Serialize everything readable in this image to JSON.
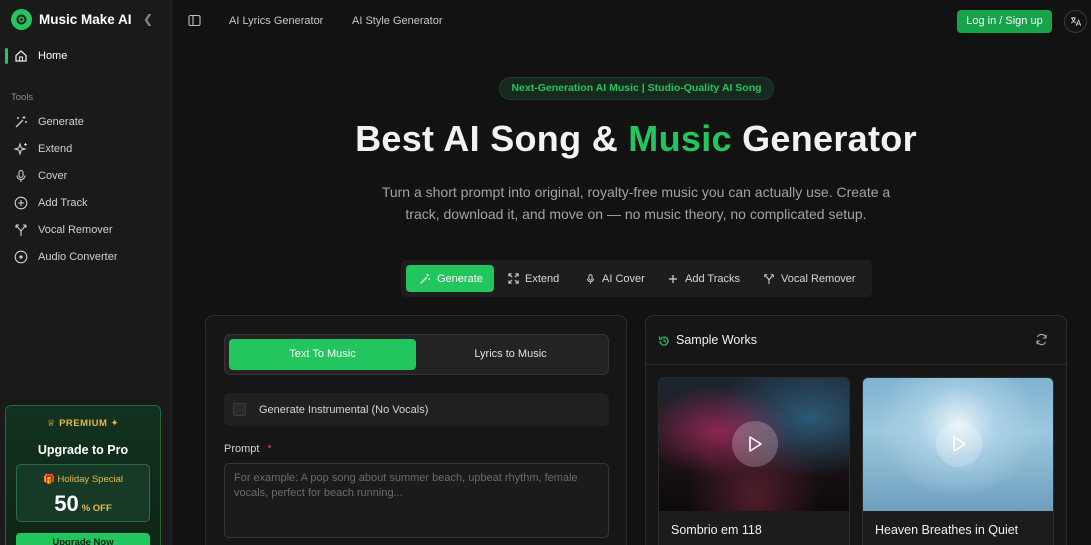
{
  "app": {
    "name": "Music Make AI"
  },
  "sidebar": {
    "home_label": "Home",
    "tools_title": "Tools",
    "items": [
      {
        "label": "Generate",
        "icon": "magic-wand-icon"
      },
      {
        "label": "Extend",
        "icon": "sparkles-icon"
      },
      {
        "label": "Cover",
        "icon": "microphone-icon"
      },
      {
        "label": "Add Track",
        "icon": "plus-circle-icon"
      },
      {
        "label": "Vocal Remover",
        "icon": "split-icon"
      },
      {
        "label": "Audio Converter",
        "icon": "disc-icon"
      }
    ],
    "promo": {
      "premium": "PREMIUM",
      "upgrade": "Upgrade to Pro",
      "holiday": "Holiday Special",
      "discount_value": "50",
      "discount_unit": "% OFF",
      "button": "Upgrade Now"
    }
  },
  "topbar": {
    "links": [
      "AI Lyrics Generator",
      "AI Style Generator"
    ],
    "login": "Log in / Sign up"
  },
  "hero": {
    "badge": "Next-Generation AI Music | Studio-Quality AI Song",
    "title_before": "Best AI Song & ",
    "title_accent": "Music",
    "title_after": " Generator",
    "subtitle": "Turn a short prompt into original, royalty-free music you can actually use. Create a track, download it, and move on — no music theory, no complicated setup."
  },
  "modes": [
    {
      "label": "Generate",
      "icon": "magic-wand-icon",
      "active": true
    },
    {
      "label": "Extend",
      "icon": "expand-icon",
      "active": false
    },
    {
      "label": "AI Cover",
      "icon": "microphone-icon",
      "active": false
    },
    {
      "label": "Add Tracks",
      "icon": "plus-icon",
      "active": false
    },
    {
      "label": "Vocal Remover",
      "icon": "split-icon",
      "active": false
    }
  ],
  "form": {
    "seg_text": "Text To Music",
    "seg_lyrics": "Lyrics to Music",
    "instrumental": "Generate Instrumental (No Vocals)",
    "prompt_label": "Prompt",
    "prompt_required": "*",
    "prompt_placeholder": "For example: A pop song about summer beach, upbeat rhythm, female vocals, perfect for beach running..."
  },
  "samples": {
    "title": "Sample Works",
    "cards": [
      {
        "title": "Sombrio em 118"
      },
      {
        "title": "Heaven Breathes in Quiet"
      }
    ]
  },
  "colors": {
    "accent": "#22c55e",
    "background": "#121212",
    "sidebar": "#1a1a1a"
  }
}
